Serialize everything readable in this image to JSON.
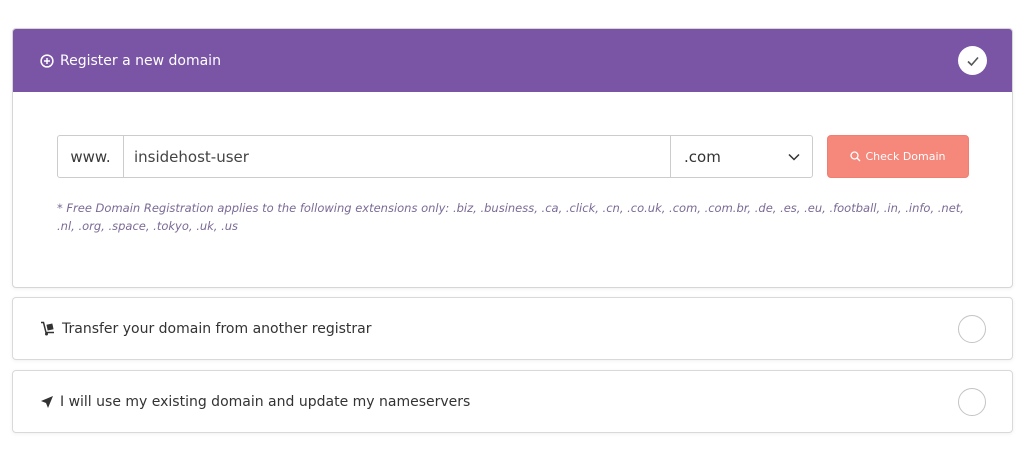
{
  "register": {
    "title": "Register a new domain",
    "prefix": "www.",
    "domain_value": "insidehost-user",
    "tld_selected": ".com",
    "check_button_label": "Check Domain",
    "note": "* Free Domain Registration applies to the following extensions only: .biz, .business, .ca, .click, .cn, .co.uk, .com, .com.br, .de, .es, .eu, .football, .in, .info, .net, .nl, .org, .space, .tokyo, .uk, .us",
    "selected": true,
    "icons": {
      "header": "plus-circle-icon",
      "check": "check-icon",
      "dropdown": "chevron-down-icon",
      "search": "search-icon"
    }
  },
  "transfer": {
    "label": "Transfer your domain from another registrar",
    "selected": false,
    "icon": "hand-truck-icon"
  },
  "existing": {
    "label": "I will use my existing domain and update my nameservers",
    "selected": false,
    "icon": "location-arrow-icon"
  },
  "colors": {
    "header_bg": "#7a55a5",
    "button_bg": "#f5877b",
    "note_text": "#7b6a95"
  }
}
